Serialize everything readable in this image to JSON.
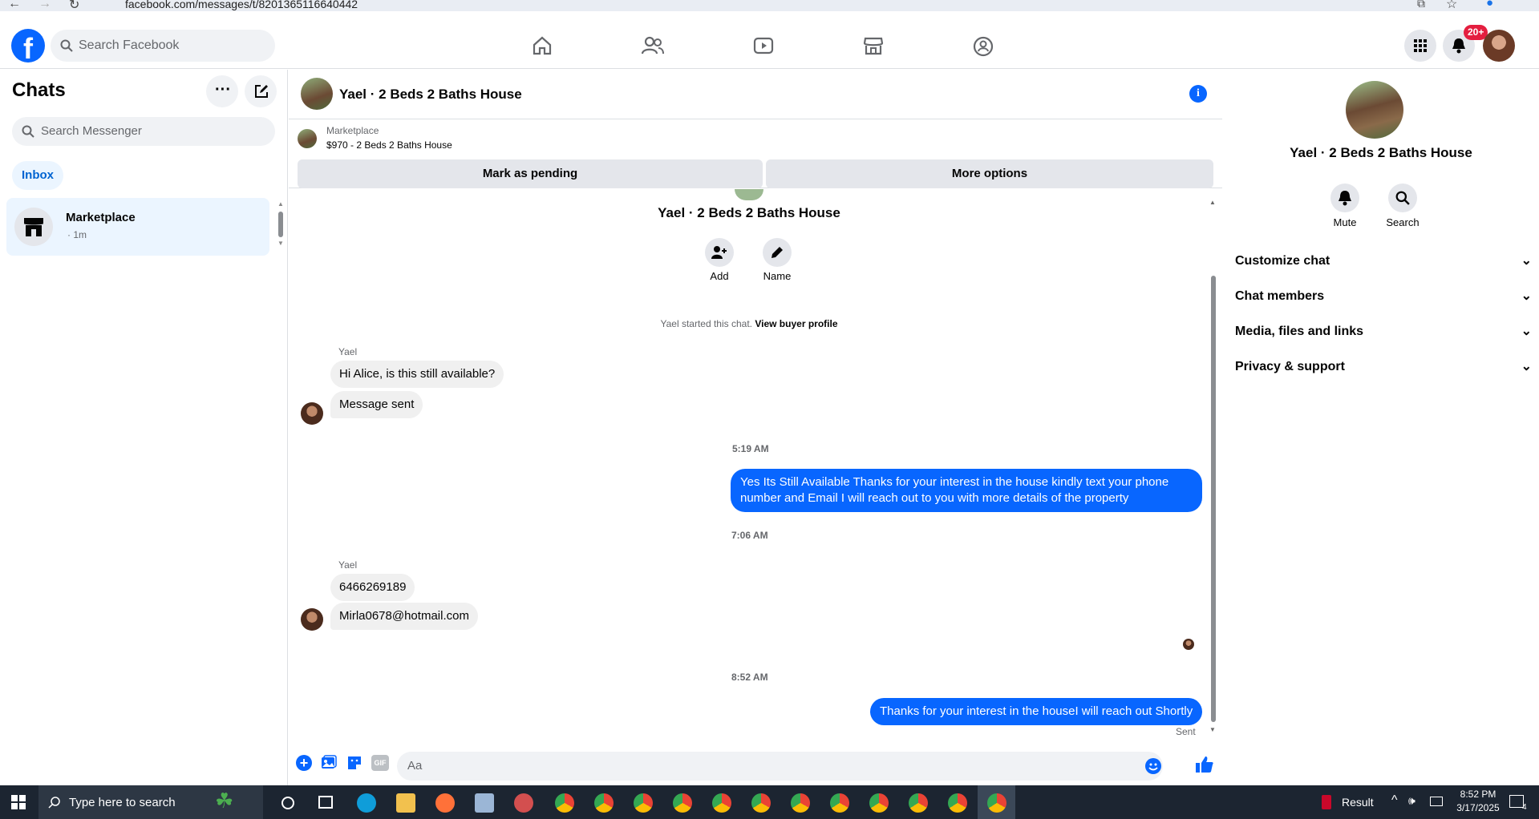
{
  "browser": {
    "url": "facebook.com/messages/t/8201365116640442"
  },
  "topnav": {
    "search_placeholder": "Search Facebook",
    "notifications_badge": "20+",
    "icons": [
      "home-icon",
      "friends-icon",
      "watch-icon",
      "marketplace-icon",
      "groups-icon"
    ]
  },
  "left": {
    "title": "Chats",
    "search_placeholder": "Search Messenger",
    "inbox_label": "Inbox",
    "chats": [
      {
        "name": "Marketplace",
        "meta": "· 1m"
      }
    ]
  },
  "main": {
    "header_title": "Yael · 2 Beds 2 Baths House",
    "marketplace_label": "Marketplace",
    "listing": "$970 - 2 Beds 2 Baths House",
    "mark_pending": "Mark as pending",
    "more_options": "More options",
    "convo_title": "Yael · 2 Beds 2 Baths House",
    "add_label": "Add",
    "name_label": "Name",
    "started_text": "Yael started this chat.",
    "view_profile": "View buyer profile",
    "messages": {
      "sender1": "Yael",
      "m1": "Hi Alice, is this still available?",
      "m2": "Message sent",
      "t1": "5:19 AM",
      "out1": "Yes Its Still Available Thanks for your interest in the house kindly text your phone number and Email I will reach out to you with more details of the property",
      "t2": "7:06 AM",
      "sender2": "Yael",
      "m3": "6466269189",
      "m4": "Mirla0678@hotmail.com",
      "t3": "8:52 AM",
      "out2": "Thanks for your interest in the houseI will reach out Shortly",
      "status": "Sent"
    },
    "composer_placeholder": "Aa"
  },
  "right": {
    "title": "Yael · 2 Beds 2 Baths House",
    "mute": "Mute",
    "search": "Search",
    "sections": [
      "Customize chat",
      "Chat members",
      "Media, files and links",
      "Privacy & support"
    ]
  },
  "taskbar": {
    "search_placeholder": "Type here to search",
    "result": "Result",
    "time": "8:52 PM",
    "date": "3/17/2025",
    "notif_count": "4"
  },
  "colors": {
    "accent": "#0866ff",
    "bubble_in": "#f0f0f0",
    "selected": "#ebf5ff"
  }
}
